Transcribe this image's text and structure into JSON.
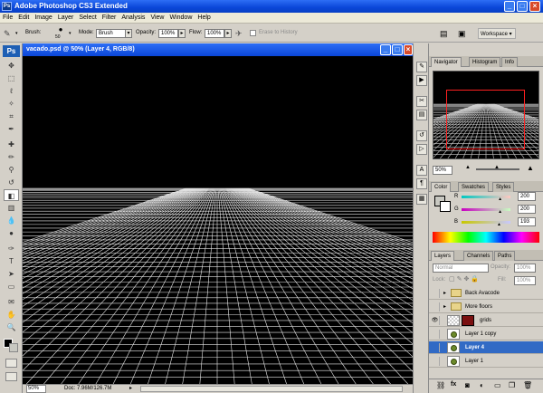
{
  "window": {
    "title": "Adobe Photoshop CS3 Extended",
    "app_icon": "Ps"
  },
  "menu": [
    "File",
    "Edit",
    "Image",
    "Layer",
    "Select",
    "Filter",
    "Analysis",
    "View",
    "Window",
    "Help"
  ],
  "options": {
    "brush_label": "Brush:",
    "brush_size": "50",
    "mode_label": "Mode:",
    "mode_value": "Brush",
    "opacity_label": "Opacity:",
    "opacity_value": "100%",
    "flow_label": "Flow:",
    "flow_value": "100%",
    "erase_history_label": "Erase to History",
    "workspace_label": "Workspace"
  },
  "toolbox": {
    "logo": "Ps"
  },
  "document": {
    "title": "vacado.psd @ 50% (Layer 4, RGB/8)",
    "zoom": "50%",
    "doc_size": "Doc: 7.96M/126.7M"
  },
  "navigator": {
    "tabs": [
      "Navigator",
      "Histogram",
      "Info"
    ],
    "zoom": "50%"
  },
  "color_panel": {
    "tabs": [
      "Color",
      "Swatches",
      "Styles"
    ],
    "channels": [
      {
        "label": "R",
        "value": "200",
        "fraction": 0.78
      },
      {
        "label": "G",
        "value": "200",
        "fraction": 0.78
      },
      {
        "label": "B",
        "value": "193",
        "fraction": 0.76
      }
    ],
    "swatch_color": "#c8c8c1"
  },
  "layers_panel": {
    "tabs": [
      "Layers",
      "Channels",
      "Paths"
    ],
    "blend_mode": "Normal",
    "opacity_label": "Opacity:",
    "opacity_value": "100%",
    "lock_label": "Lock:",
    "fill_label": "Fill:",
    "fill_value": "100%",
    "layers": [
      {
        "name": "Back Avacode",
        "kind": "folder",
        "visible": false,
        "selected": false
      },
      {
        "name": "More floors",
        "kind": "folder",
        "visible": false,
        "selected": false
      },
      {
        "name": "grids",
        "kind": "masked",
        "visible": true,
        "selected": false
      },
      {
        "name": "Layer 1 copy",
        "kind": "layer",
        "visible": false,
        "selected": false
      },
      {
        "name": "Layer 4",
        "kind": "layer",
        "visible": false,
        "selected": true
      },
      {
        "name": "Layer 1",
        "kind": "layer",
        "visible": false,
        "selected": false
      }
    ]
  }
}
